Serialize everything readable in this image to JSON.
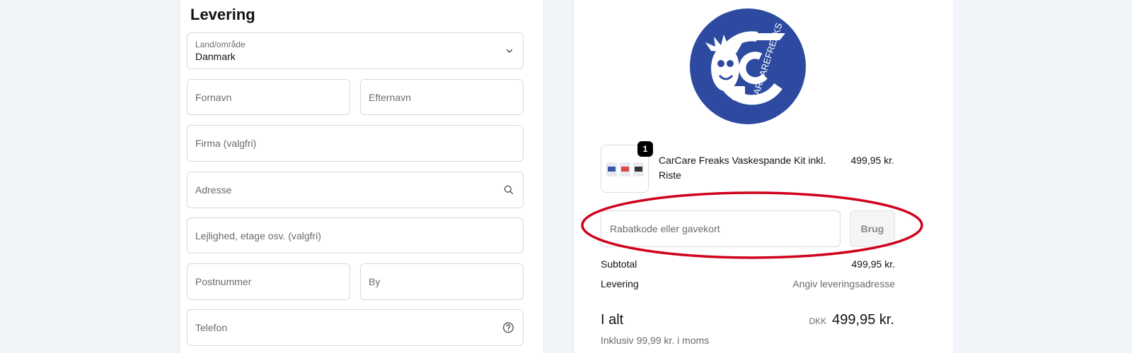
{
  "delivery": {
    "title": "Levering",
    "country": {
      "label": "Land/område",
      "value": "Danmark"
    },
    "first_name": {
      "placeholder": "Fornavn"
    },
    "last_name": {
      "placeholder": "Efternavn"
    },
    "company": {
      "placeholder": "Firma (valgfri)"
    },
    "address": {
      "placeholder": "Adresse"
    },
    "apartment": {
      "placeholder": "Lejlighed, etage osv. (valgfri)"
    },
    "postal_code": {
      "placeholder": "Postnummer"
    },
    "city": {
      "placeholder": "By"
    },
    "phone": {
      "placeholder": "Telefon"
    }
  },
  "summary": {
    "logo_icon": "carcarefreaks-logo",
    "logo_text": "CARCAREFREAKS",
    "product": {
      "quantity": "1",
      "name": "CarCare Freaks Vaskespande Kit inkl. Riste",
      "price": "499,95 kr."
    },
    "discount": {
      "placeholder": "Rabatkode eller gavekort",
      "apply_label": "Brug"
    },
    "subtotal": {
      "label": "Subtotal",
      "value": "499,95 kr."
    },
    "shipping": {
      "label": "Levering",
      "value": "Angiv leveringsadresse"
    },
    "total": {
      "label": "I alt",
      "currency": "DKK",
      "value": "499,95 kr."
    },
    "tax_note": "Inklusiv 99,99 kr. i moms"
  },
  "colors": {
    "brand_blue": "#2d4aa0",
    "highlight_red": "#d0021b",
    "page_bg": "#f1f4f9"
  }
}
